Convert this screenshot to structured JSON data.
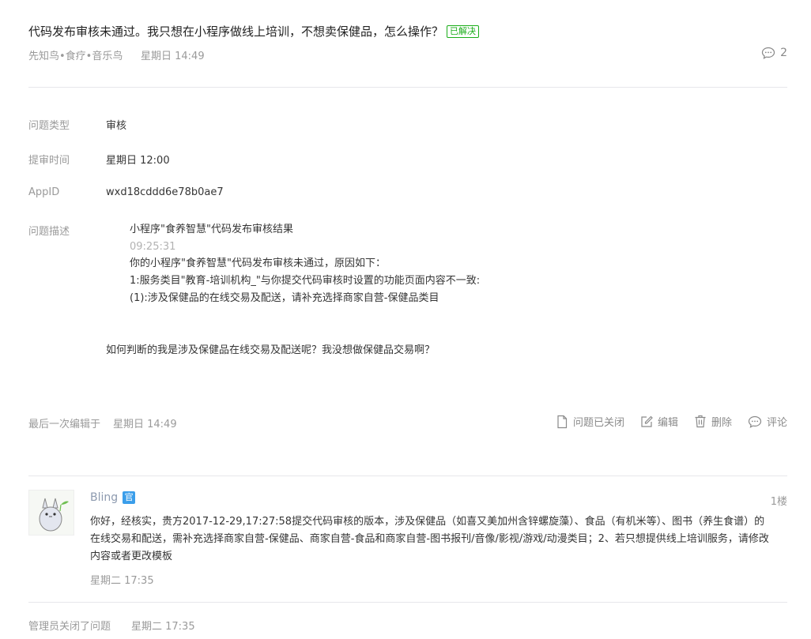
{
  "question": {
    "title": "代码发布审核未通过。我只想在小程序做线上培训，不想卖保健品，怎么操作？",
    "status_badge": "已解决",
    "author": "先知鸟•食疗•音乐鸟",
    "time": "星期日 14:49",
    "comment_count": "2",
    "icon": "comment-bubble-icon"
  },
  "info": {
    "type_label": "问题类型",
    "type_value": "审核",
    "submit_time_label": "提审时间",
    "submit_time_value": "星期日 12:00",
    "appid_label": "AppID",
    "appid_value": "wxd18cddd6e78b0ae7",
    "desc_label": "问题描述"
  },
  "description": {
    "line1": "小程序\"食养智慧\"代码发布审核结果",
    "time": "09:25:31",
    "line2": "你的小程序\"食养智慧\"代码发布审核未通过，原因如下：",
    "line3": "1:服务类目\"教育-培训机构_\"与你提交代码审核时设置的功能页面内容不一致:",
    "line4": "(1):涉及保健品的在线交易及配送，请补充选择商家自营-保健品类目",
    "question": "如何判断的我是涉及保健品在线交易及配送呢？我没想做保健品交易啊？"
  },
  "edit": {
    "label": "最后一次编辑于",
    "time": "星期日 14:49"
  },
  "actions": {
    "closed": "问题已关闭",
    "edit": "编辑",
    "delete": "删除",
    "comment": "评论"
  },
  "reply": {
    "author": "Bling",
    "official_badge": "官",
    "floor": "1楼",
    "body": "你好，经核实，贵方2017-12-29,17:27:58提交代码审核的版本，涉及保健品（如喜又美加州含锌螺旋藻）、食品（有机米等）、图书（养生食谱）的在线交易和配送，需补充选择商家自营-保健品、商家自营-食品和商家自营-图书报刊/音像/影视/游戏/动漫类目；2、若只想提供线上培训服务，请修改内容或者更改模板",
    "time": "星期二 17:35"
  },
  "closed_note": {
    "label": "管理员关闭了问题",
    "time": "星期二 17:35"
  },
  "colors": {
    "solved_green": "#1aad19",
    "official_blue": "#3b9eea",
    "divider": "#e7e7eb"
  }
}
